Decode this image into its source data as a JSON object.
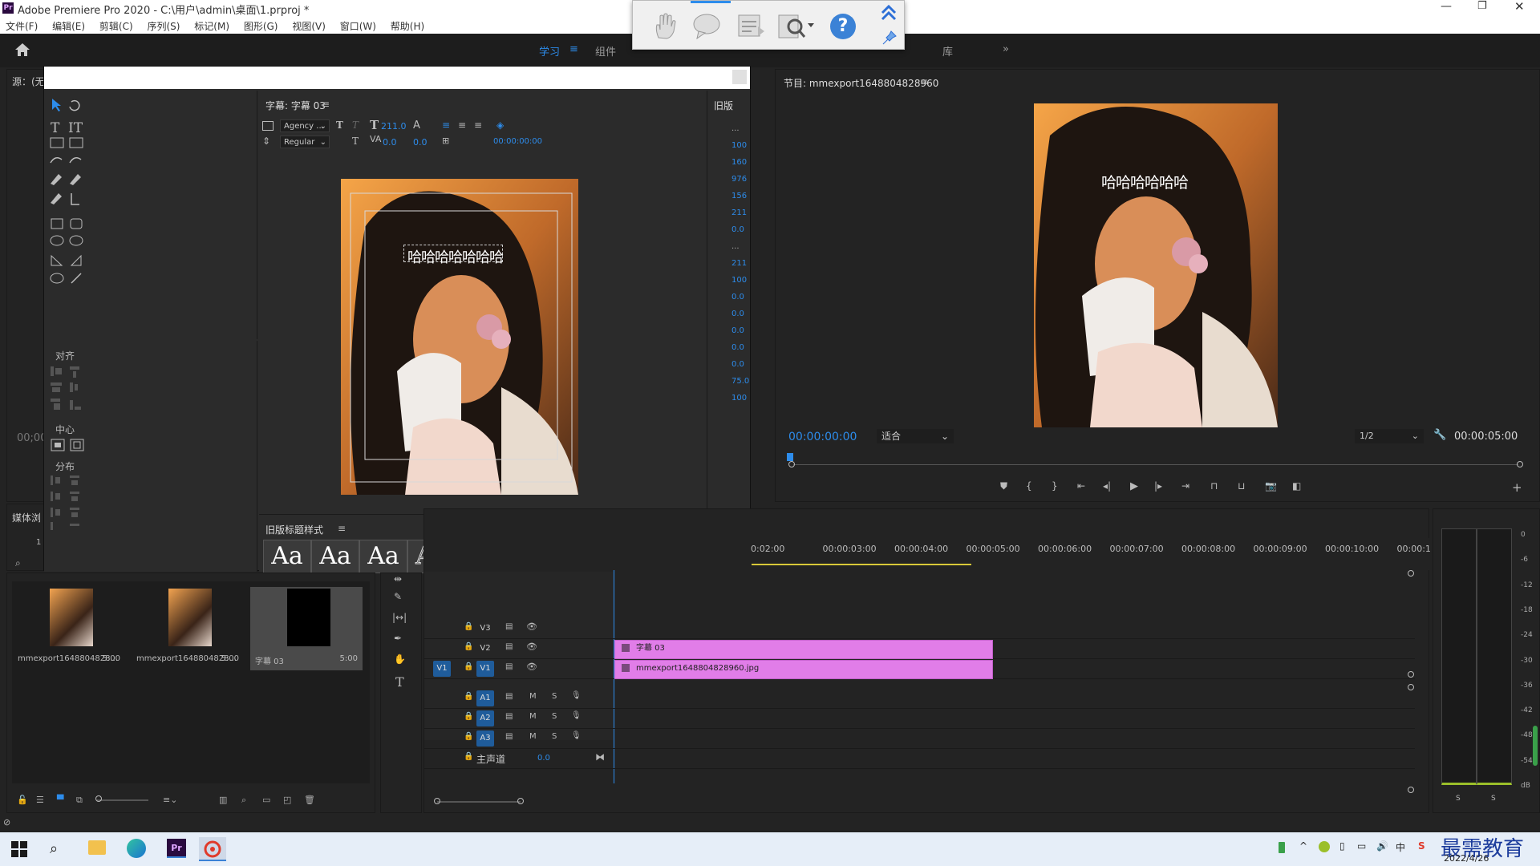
{
  "window": {
    "app_icon": "Pr",
    "title": "Adobe Premiere Pro 2020 - C:\\用户\\admin\\桌面\\1.prproj *"
  },
  "menu": [
    "文件(F)",
    "编辑(E)",
    "剪辑(C)",
    "序列(S)",
    "标记(M)",
    "图形(G)",
    "视图(V)",
    "窗口(W)",
    "帮助(H)"
  ],
  "workspace_tabs": {
    "learn": "学习",
    "assembly": "组件",
    "library": "库"
  },
  "source_panel": {
    "title": "源：(无",
    "timecode": "00;00"
  },
  "media_panel": {
    "title": "媒体浏",
    "count": "1"
  },
  "tools": {
    "align": "对齐",
    "center": "中心",
    "distribute": "分布"
  },
  "title_editor": {
    "tab": "字幕: 字幕 03",
    "font": "Agency ...",
    "style": "Regular",
    "size": "211.0",
    "kerning": "0.0",
    "leading": "0.0",
    "timecode": "00:00:00:00",
    "caption_text": "哈哈哈哈哈哈哈"
  },
  "legacy_props": {
    "title": "旧版",
    "values": [
      "...",
      "100",
      "160",
      "976",
      "156",
      "211",
      "0.0",
      "...",
      "211",
      "100",
      "0.0",
      "0.0",
      "0.0",
      "0.0",
      "0.0",
      "75.0",
      "100"
    ]
  },
  "title_styles": {
    "title": "旧版标题样式",
    "sample": "Aa"
  },
  "program_monitor": {
    "title": "节目: mmexport1648804828960",
    "caption_text": "哈哈哈哈哈哈",
    "timecode_left": "00:00:00:00",
    "fit": "适合",
    "resolution": "1/2",
    "timecode_right": "00:00:05:00"
  },
  "project_items": [
    {
      "name": "mmexport1648804828...",
      "duration": "5:00"
    },
    {
      "name": "mmexport1648804828...",
      "duration": "5:00"
    },
    {
      "name": "字幕 03",
      "duration": "5:00"
    }
  ],
  "timeline": {
    "ruler": [
      "0:02:00",
      "00:00:03:00",
      "00:00:04:00",
      "00:00:05:00",
      "00:00:06:00",
      "00:00:07:00",
      "00:00:08:00",
      "00:00:09:00",
      "00:00:10:00",
      "00:00:1"
    ],
    "tracks_video": [
      "V3",
      "V2",
      "V1"
    ],
    "tracks_audio": [
      "A1",
      "A2",
      "A3"
    ],
    "source_patch": "V1",
    "mute": "M",
    "solo": "S",
    "master_label": "主声道",
    "master_value": "0.0",
    "clip_title": "字幕 03",
    "clip_image": "mmexport1648804828960.jpg"
  },
  "audio_meter": {
    "ticks": [
      "0",
      "-6",
      "-12",
      "-18",
      "-24",
      "-30",
      "-36",
      "-42",
      "-48",
      "-54",
      "dB"
    ],
    "solo": "S"
  },
  "taskbar": {
    "watermark": "最需教育",
    "date": "2022/4/26"
  },
  "colors": {
    "accent_blue": "#2d8ceb",
    "clip_pink": "#e17de8",
    "panel": "#232323"
  }
}
